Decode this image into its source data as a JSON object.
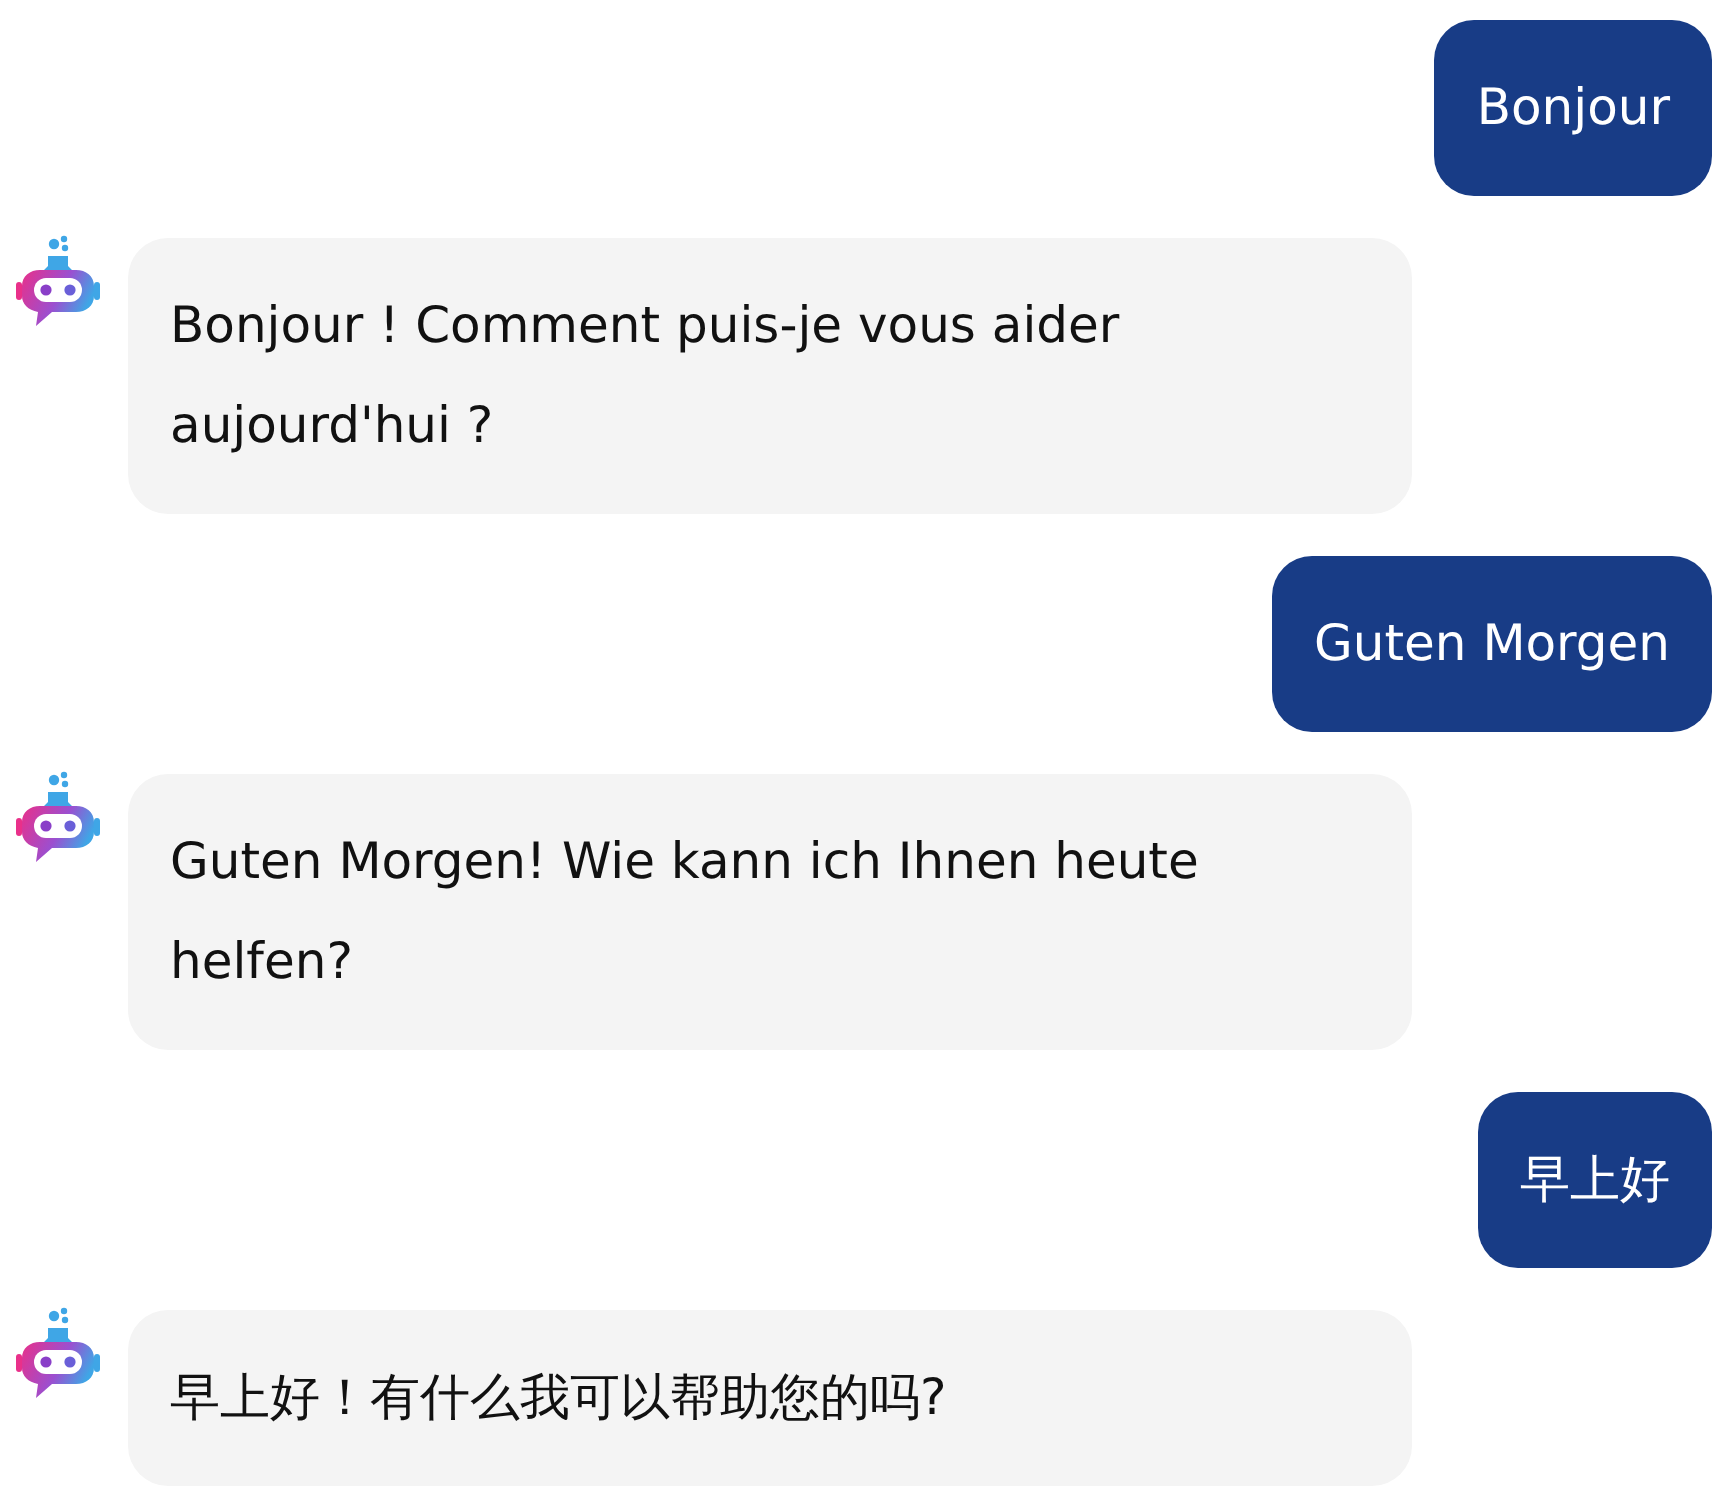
{
  "messages": [
    {
      "kind": "user",
      "text": "Bonjour"
    },
    {
      "kind": "bot",
      "text": "Bonjour ! Comment puis-je vous aider aujourd'hui ?"
    },
    {
      "kind": "user",
      "text": "Guten Morgen"
    },
    {
      "kind": "bot",
      "text": "Guten Morgen! Wie kann ich Ihnen heute helfen?"
    },
    {
      "kind": "user",
      "text": "早上好"
    },
    {
      "kind": "bot",
      "text": "早上好！有什么我可以帮助您的吗?"
    }
  ]
}
